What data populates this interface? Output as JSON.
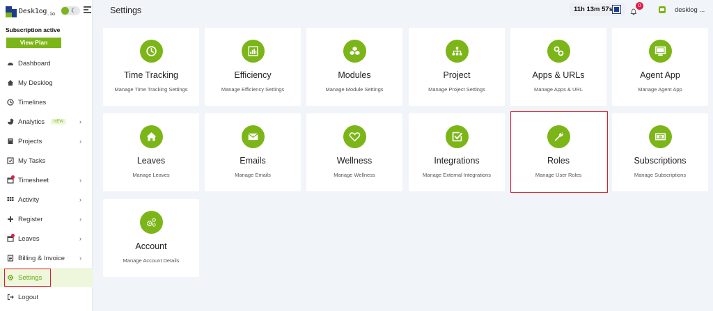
{
  "brand": {
    "name": "Desk1og",
    "suffix": ".io"
  },
  "subscription": {
    "status": "Subscription active",
    "view_plan_label": "View Plan"
  },
  "nav": [
    {
      "label": "Dashboard",
      "icon": "dashboard-icon"
    },
    {
      "label": "My Desklog",
      "icon": "home-icon"
    },
    {
      "label": "Timelines",
      "icon": "clock-icon"
    },
    {
      "label": "Analytics",
      "icon": "pie-chart-icon",
      "badge": "NEW",
      "chevron": "›"
    },
    {
      "label": "Projects",
      "icon": "folder-icon",
      "chevron": "›"
    },
    {
      "label": "My Tasks",
      "icon": "tasks-icon"
    },
    {
      "label": "Timesheet",
      "icon": "calendar-icon",
      "chevron": "›"
    },
    {
      "label": "Activity",
      "icon": "grid-icon",
      "chevron": "›"
    },
    {
      "label": "Register",
      "icon": "plus-icon",
      "chevron": "›"
    },
    {
      "label": "Leaves",
      "icon": "leave-calendar-icon",
      "chevron": "›"
    },
    {
      "label": "Billing & Invoice",
      "icon": "billing-icon",
      "chevron": "›"
    },
    {
      "label": "Settings",
      "icon": "gear-icon"
    },
    {
      "label": "Logout",
      "icon": "logout-icon"
    }
  ],
  "header": {
    "title": "Settings",
    "timer": "11h 13m 57s",
    "notification_count": "0",
    "user_name": "desklog ..."
  },
  "cards": [
    {
      "title": "Time Tracking",
      "subtitle": "Manage Time Tracking Settings",
      "icon": "clock-icon"
    },
    {
      "title": "Efficiency",
      "subtitle": "Manage Efficiency Settings",
      "icon": "bar-chart-icon"
    },
    {
      "title": "Modules",
      "subtitle": "Manage Module Settings",
      "icon": "cubes-icon"
    },
    {
      "title": "Project",
      "subtitle": "Manage Project Settings",
      "icon": "sitemap-icon"
    },
    {
      "title": "Apps & URLs",
      "subtitle": "Manage Apps & URL",
      "icon": "link-icon"
    },
    {
      "title": "Agent App",
      "subtitle": "Manage Agent App",
      "icon": "monitor-icon"
    },
    {
      "title": "Leaves",
      "subtitle": "Manage Leaves",
      "icon": "home-icon"
    },
    {
      "title": "Emails",
      "subtitle": "Manage Emails",
      "icon": "envelope-icon"
    },
    {
      "title": "Wellness",
      "subtitle": "Manage Wellness",
      "icon": "heart-icon"
    },
    {
      "title": "Integrations",
      "subtitle": "Manage External Integrations",
      "icon": "check-square-icon"
    },
    {
      "title": "Roles",
      "subtitle": "Manage User Roles",
      "icon": "wrench-icon"
    },
    {
      "title": "Subscriptions",
      "subtitle": "Manage Subscriptions",
      "icon": "money-bill-icon"
    },
    {
      "title": "Account",
      "subtitle": "Manage Account Details",
      "icon": "cogs-icon"
    }
  ],
  "colors": {
    "accent": "#7cb518",
    "highlight": "#e01b2a",
    "brand_blue": "#1f3b8c"
  }
}
